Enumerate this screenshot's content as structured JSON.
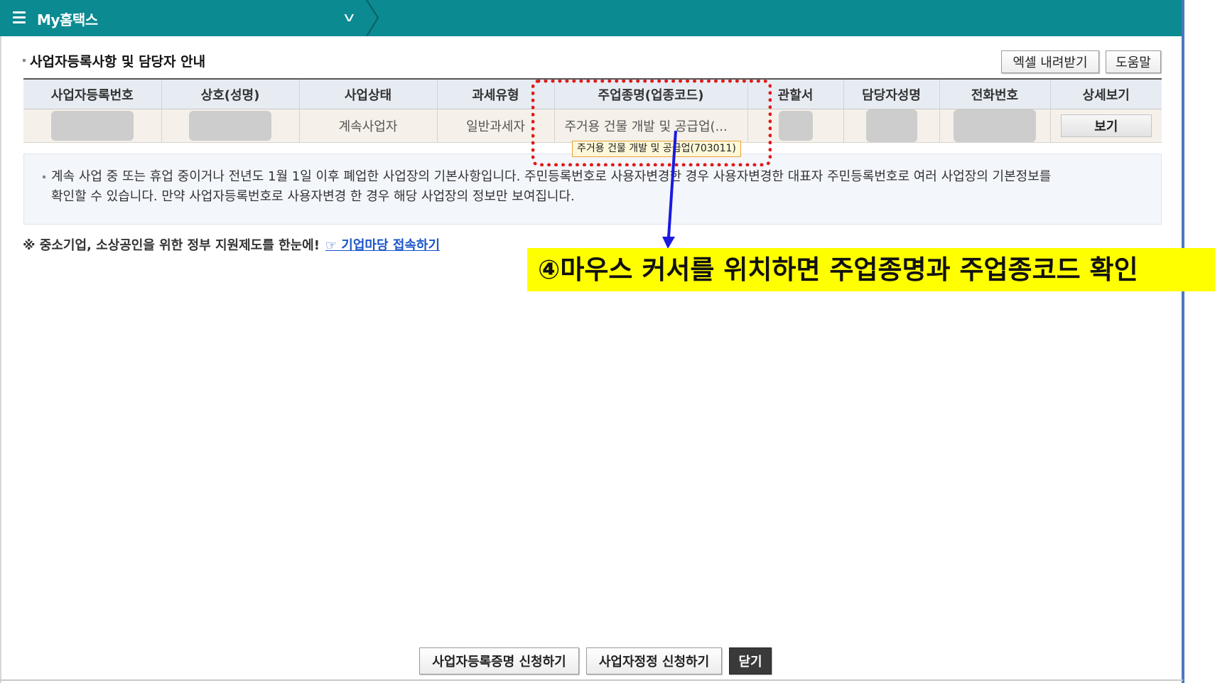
{
  "topbar": {
    "title": "My홈택스"
  },
  "section": {
    "title": "사업자등록사항 및 담당자 안내",
    "excel_button": "엑셀 내려받기",
    "help_button": "도움말"
  },
  "table": {
    "headers": [
      "사업자등록번호",
      "상호(성명)",
      "사업상태",
      "과세유형",
      "주업종명(업종코드)",
      "관할서",
      "담당자성명",
      "전화번호",
      "상세보기"
    ],
    "row": {
      "status": "계속사업자",
      "tax_type": "일반과세자",
      "business_type": "주거용 건물 개발 및 공급업(...",
      "view_button": "보기"
    }
  },
  "tooltip": {
    "text": "주거용 건물 개발 및 공급업(703011)"
  },
  "info": {
    "line1": "계속 사업 중 또는 휴업 중이거나 전년도 1월 1일 이후 폐업한 사업장의 기본사항입니다. 주민등록번호로 사용자변경한 경우 사용자변경한 대표자 주민등록번호로 여러 사업장의 기본정보를",
    "line2": "확인할 수 있습니다. 만약 사업자등록번호로 사용자변경 한 경우 해당 사업장의 정보만 보여집니다."
  },
  "notice": {
    "text": "※ 중소기업, 소상공인을 위한 정부 지원제도를 한눈에!",
    "link": "☞ 기업마당 접속하기"
  },
  "annotation": {
    "text": "④마우스 커서를 위치하면 주업종명과 주업종코드 확인"
  },
  "bottom": {
    "cert_button": "사업자등록증명 신청하기",
    "correct_button": "사업자정정 신청하기",
    "close_button": "닫기"
  },
  "colors": {
    "header_bar": "#0b8a91",
    "annotation_bg": "#ffff00",
    "highlight_border": "#e01a1a",
    "arrow": "#1a1ae0",
    "link": "#1b56c9"
  },
  "icons": [
    "menu-icon",
    "chevron-down-icon"
  ]
}
